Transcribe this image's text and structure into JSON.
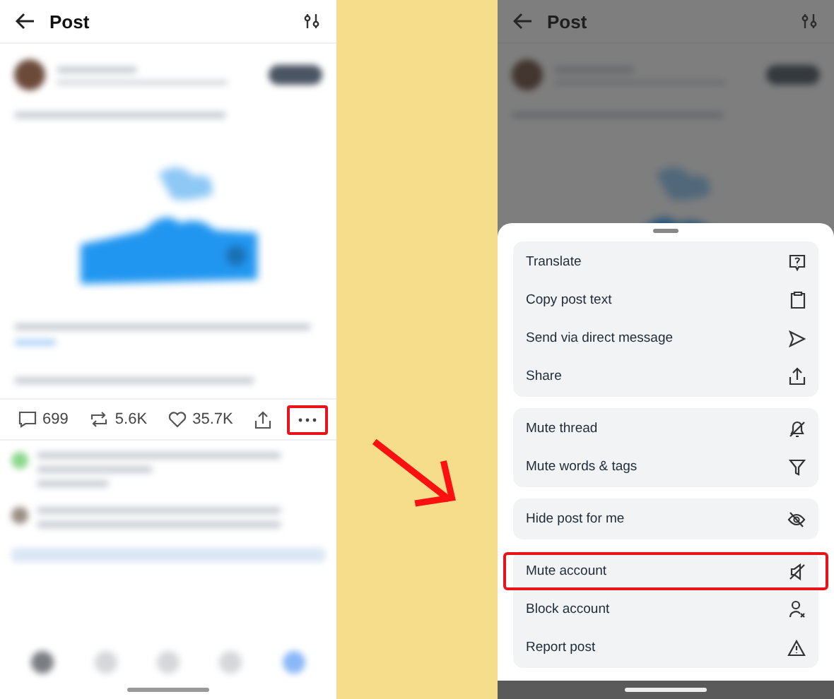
{
  "screens": [
    {
      "header": {
        "title": "Post"
      },
      "actions": [
        {
          "kind": "reply",
          "label": "699",
          "highlighted": false
        },
        {
          "kind": "repost",
          "label": "5.6K",
          "highlighted": false
        },
        {
          "kind": "like",
          "label": "35.7K",
          "highlighted": false
        },
        {
          "kind": "share",
          "highlighted": false
        },
        {
          "kind": "more",
          "highlighted": true
        }
      ]
    },
    {
      "header": {
        "title": "Post"
      },
      "menu_groups": [
        {
          "items": [
            {
              "label": "Translate",
              "kind": "translate",
              "highlighted": false
            },
            {
              "label": "Copy post text",
              "kind": "copy",
              "highlighted": false
            },
            {
              "label": "Send via direct message",
              "kind": "send",
              "highlighted": false
            },
            {
              "label": "Share",
              "kind": "share",
              "highlighted": false
            }
          ]
        },
        {
          "items": [
            {
              "label": "Mute thread",
              "kind": "mute-thread",
              "highlighted": false
            },
            {
              "label": "Mute words & tags",
              "kind": "filter",
              "highlighted": false
            }
          ]
        },
        {
          "items": [
            {
              "label": "Hide post for me",
              "kind": "hide",
              "highlighted": false
            }
          ]
        },
        {
          "items": [
            {
              "label": "Mute account",
              "kind": "mute",
              "highlighted": true
            },
            {
              "label": "Block account",
              "kind": "block",
              "highlighted": false
            },
            {
              "label": "Report post",
              "kind": "report",
              "highlighted": false
            }
          ]
        }
      ]
    }
  ]
}
